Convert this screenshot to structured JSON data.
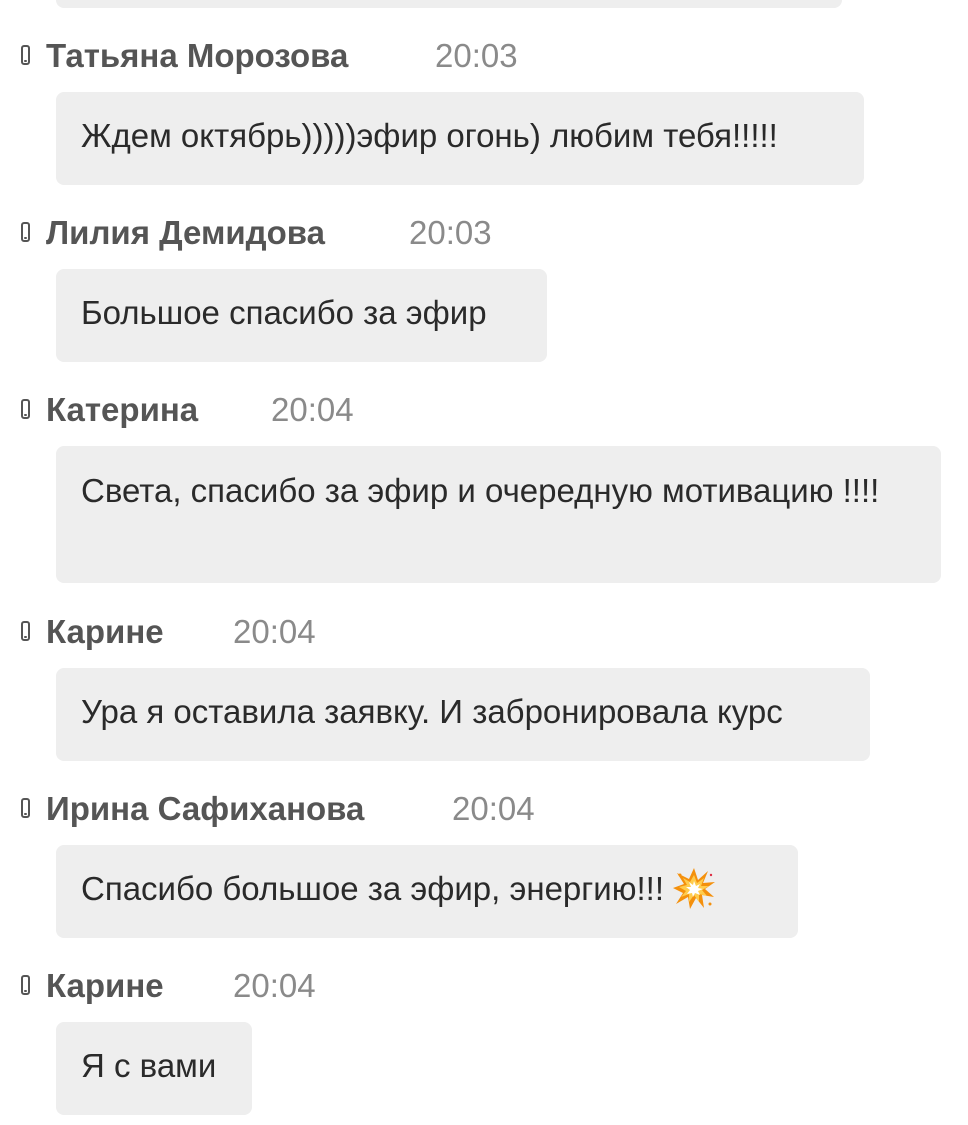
{
  "messages": [
    {
      "author": "Татьяна Морозова",
      "time": "20:03",
      "text": "Ждем октябрь)))))эфир огонь) любим тебя!!!!!"
    },
    {
      "author": "Лилия Демидова",
      "time": "20:03",
      "text": "Большое спасибо за эфир"
    },
    {
      "author": "Катерина",
      "time": "20:04",
      "text": "Света, спасибо за эфир и очередную мотивацию !!!!"
    },
    {
      "author": "Карине",
      "time": "20:04",
      "text": "Ура я оставила заявку. И забронировала курс"
    },
    {
      "author": "Ирина Сафиханова",
      "time": "20:04",
      "text": "Спасибо большое за эфир, энергию!!!",
      "emoji": "collision-emoji"
    },
    {
      "author": "Карине",
      "time": "20:04",
      "text": "Я с вами"
    }
  ],
  "colors": {
    "bubble": "#eeeeee",
    "author": "#555555",
    "time": "#8a8a8a",
    "text": "#2a2a2a"
  }
}
